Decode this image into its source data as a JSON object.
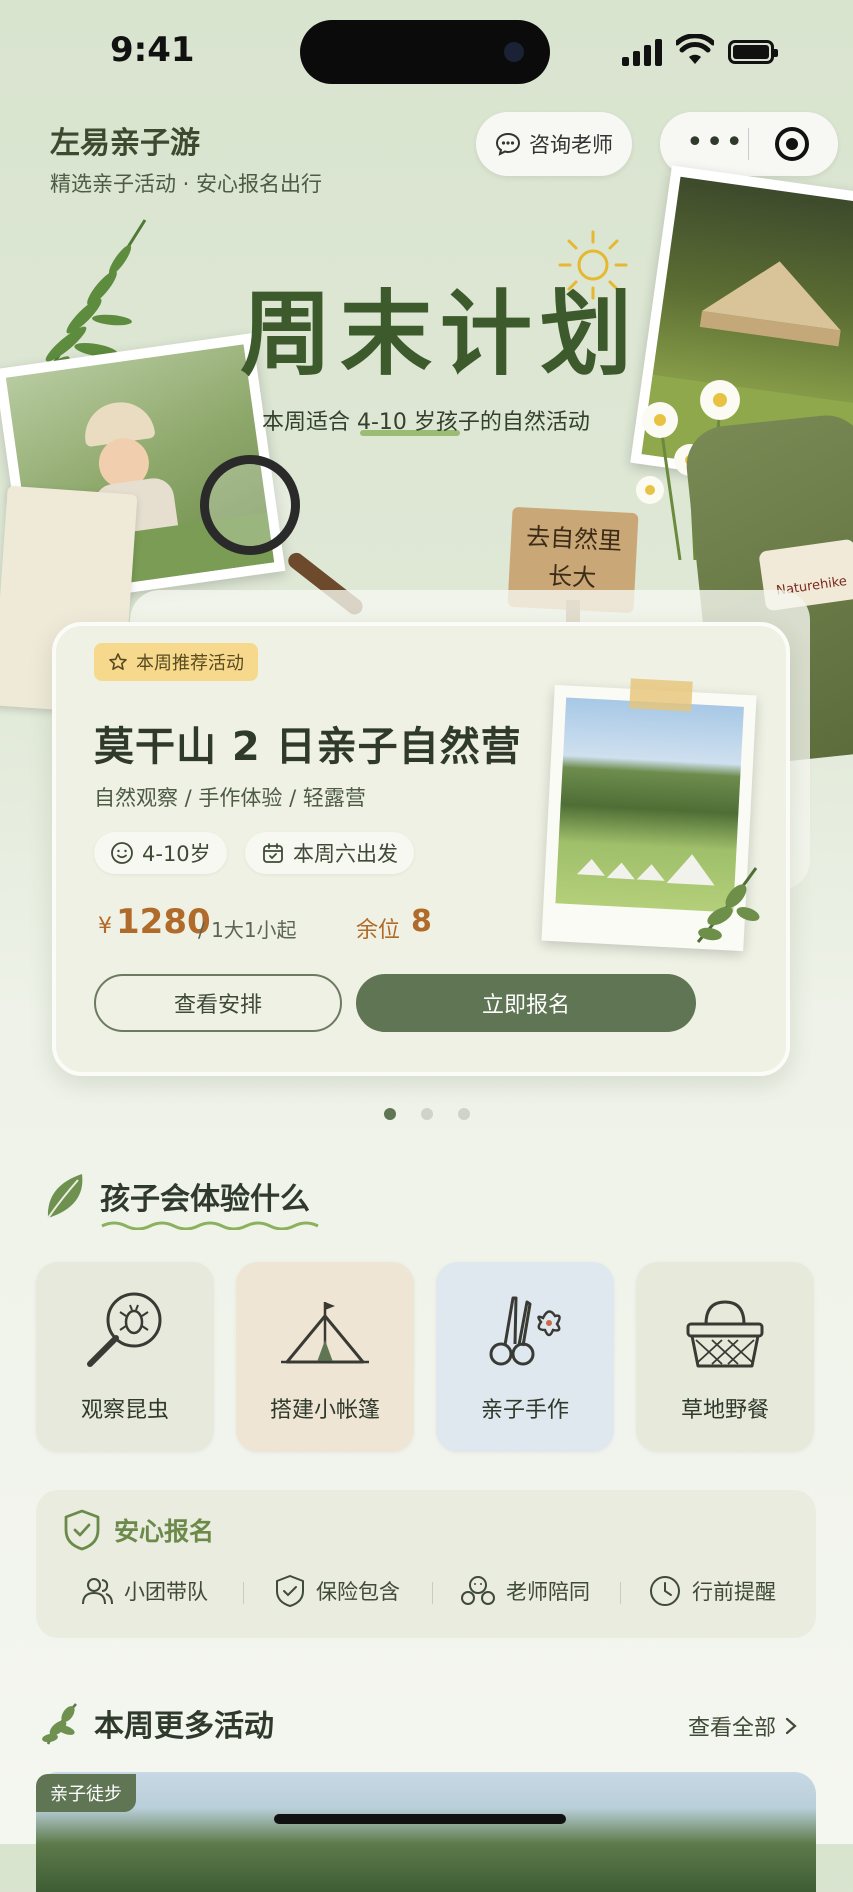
{
  "status_bar": {
    "time": "9:41"
  },
  "header": {
    "title": "左易亲子游",
    "subtitle": "精选亲子活动 · 安心报名出行",
    "consult_label": "咨询老师"
  },
  "hero": {
    "title": "周末计划",
    "subtitle": "本周适合 4-10 岁孩子的自然活动",
    "sign_line1": "去自然里",
    "sign_line2": "长大",
    "backpack_label": "Naturehike"
  },
  "featured": {
    "badge": "本周推荐活动",
    "title": "莫干山 2 日亲子自然营",
    "tags": "自然观察 / 手作体验 / 轻露营",
    "age": "4-10岁",
    "date": "本周六出发",
    "currency": "¥",
    "price": "1280",
    "price_unit": "/ 1大1小起",
    "seats_label": "余位",
    "seats": "8",
    "secondary_btn": "查看安排",
    "primary_btn": "立即报名",
    "carousel_index": 1,
    "carousel_total": 3
  },
  "experience": {
    "title": "孩子会体验什么",
    "items": [
      {
        "label": "观察昆虫",
        "icon": "magnifier-bug-icon"
      },
      {
        "label": "搭建小帐篷",
        "icon": "tent-icon"
      },
      {
        "label": "亲子手作",
        "icon": "scissors-icon"
      },
      {
        "label": "草地野餐",
        "icon": "picnic-basket-icon"
      }
    ]
  },
  "safety": {
    "title": "安心报名",
    "items": [
      {
        "label": "小团带队",
        "icon": "group-icon"
      },
      {
        "label": "保险包含",
        "icon": "shield-icon"
      },
      {
        "label": "老师陪同",
        "icon": "teacher-icon"
      },
      {
        "label": "行前提醒",
        "icon": "clock-icon"
      }
    ]
  },
  "more": {
    "title": "本周更多活动",
    "see_all": "查看全部",
    "first_badge": "亲子徒步"
  },
  "colors": {
    "primary": "#5f7554",
    "price": "#b06a2a",
    "badge": "#f6d98d",
    "hero_title": "#3d5a2c"
  }
}
